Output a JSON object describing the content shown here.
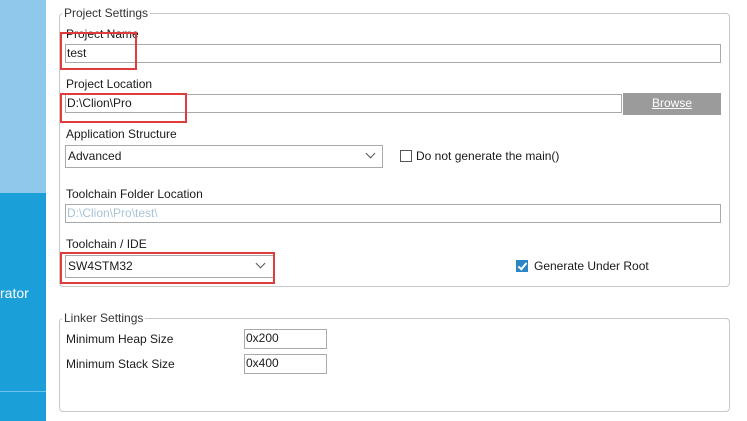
{
  "sidebar": {
    "item_text": "rator"
  },
  "project_settings": {
    "legend": "Project Settings",
    "project_name": {
      "label": "Project Name",
      "value": "test"
    },
    "project_location": {
      "label": "Project Location",
      "value": "D:\\Clion\\Pro",
      "browse_label": "Browse"
    },
    "application_structure": {
      "label": "Application Structure",
      "selected": "Advanced",
      "do_not_generate_main_label": "Do not generate the main()",
      "do_not_generate_main_checked": false
    },
    "toolchain_folder_location": {
      "label": "Toolchain Folder Location",
      "value": "D:\\Clion\\Pro\\test\\"
    },
    "toolchain_ide": {
      "label": "Toolchain / IDE",
      "selected": "SW4STM32",
      "generate_under_root_label": "Generate Under Root",
      "generate_under_root_checked": true
    }
  },
  "linker_settings": {
    "legend": "Linker Settings",
    "min_heap": {
      "label": "Minimum Heap Size",
      "value": "0x200"
    },
    "min_stack": {
      "label": "Minimum Stack Size",
      "value": "0x400"
    }
  },
  "colors": {
    "sidebar_light": "#8ec9ec",
    "sidebar_dark": "#1a9fd9",
    "highlight": "#e03c3c",
    "checkbox_checked": "#2b86c6",
    "button": "#9b9b9b"
  }
}
